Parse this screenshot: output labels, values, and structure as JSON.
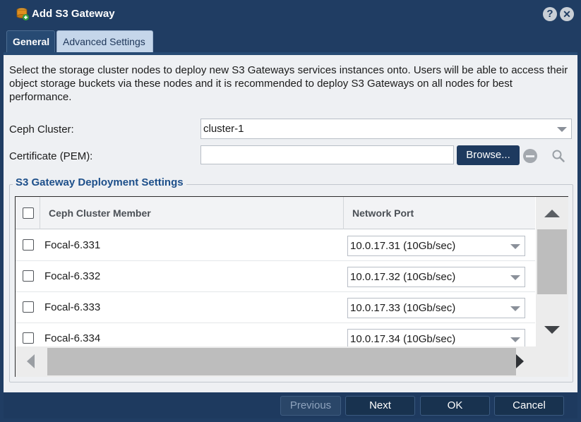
{
  "window": {
    "title": "Add S3 Gateway",
    "help_glyph": "?",
    "close_glyph": "✕"
  },
  "tabs": [
    {
      "label": "General",
      "active": true
    },
    {
      "label": "Advanced Settings",
      "active": false
    }
  ],
  "general": {
    "description": "Select the storage cluster nodes to deploy new S3 Gateways services instances onto. Users will be able to access their object storage buckets via these nodes and it is recommended to deploy S3 Gateways on all nodes for best performance.",
    "ceph_cluster_label": "Ceph Cluster:",
    "ceph_cluster_value": "cluster-1",
    "certificate_label": "Certificate (PEM):",
    "certificate_value": "",
    "browse_label": "Browse..."
  },
  "deployment": {
    "legend": "S3 Gateway Deployment Settings",
    "columns": [
      "Ceph Cluster Member",
      "Network Port"
    ],
    "rows": [
      {
        "member": "Focal-6.331",
        "port": "10.0.17.31 (10Gb/sec)",
        "checked": false
      },
      {
        "member": "Focal-6.332",
        "port": "10.0.17.32 (10Gb/sec)",
        "checked": false
      },
      {
        "member": "Focal-6.333",
        "port": "10.0.17.33 (10Gb/sec)",
        "checked": false
      },
      {
        "member": "Focal-6.334",
        "port": "10.0.17.34 (10Gb/sec)",
        "checked": false
      }
    ]
  },
  "footer": {
    "previous": "Previous",
    "next": "Next",
    "ok": "OK",
    "cancel": "Cancel"
  },
  "colors": {
    "titlebar": "#203d63",
    "accent_button": "#1e3a5f",
    "legend_text": "#1d4f8a",
    "content_bg": "#eef0f3"
  }
}
